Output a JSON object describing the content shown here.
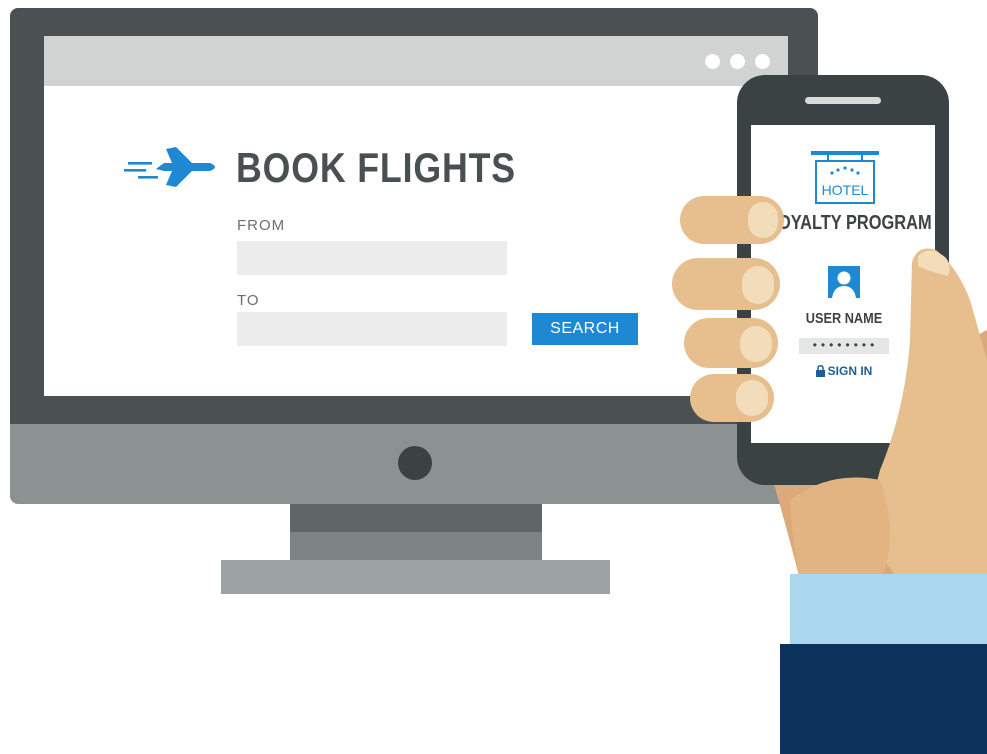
{
  "booking": {
    "title": "BOOK FLIGHTS",
    "from_label": "FROM",
    "from_value": "",
    "to_label": "TO",
    "to_value": "",
    "search_label": "SEARCH"
  },
  "phone": {
    "hotel_sign": "HOTEL",
    "program_title": "LOYALTY PROGRAM",
    "user_label": "USER NAME",
    "password_value": "••••••••",
    "signin_label": "SIGN IN"
  },
  "colors": {
    "accent_blue": "#1e88d3",
    "monitor_dark": "#4b5152",
    "skin": "#e7be8d",
    "cuff": "#acd8ef",
    "sleeve": "#0c335b"
  },
  "icons": {
    "plane": "airplane-icon",
    "window_controls": "window-dots-icon",
    "user": "user-icon",
    "lock": "lock-icon"
  }
}
